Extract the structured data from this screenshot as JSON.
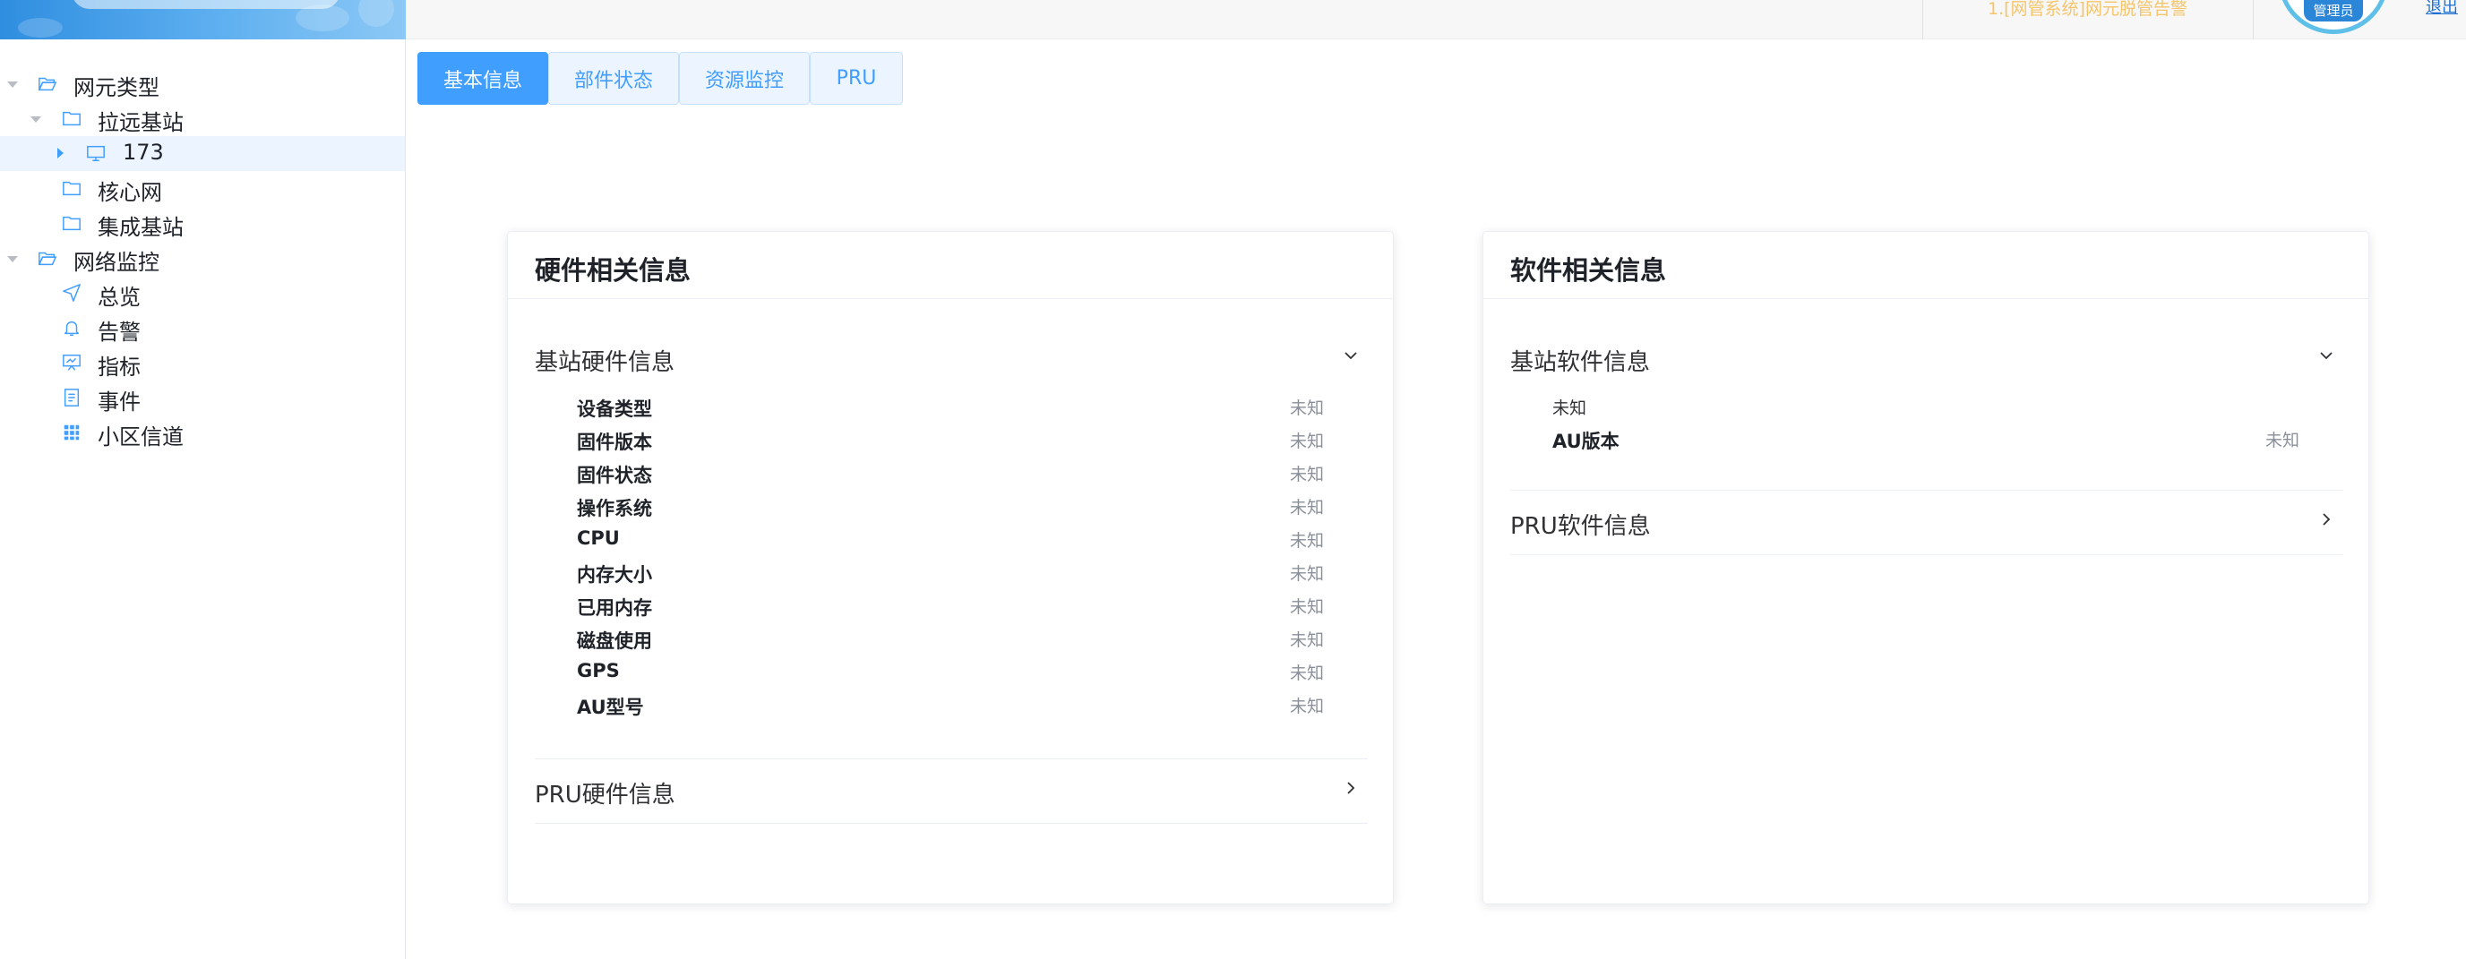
{
  "header": {
    "alert_text": "1.[网管系统]网元脱管告警",
    "avatar_badge": "管理员",
    "corner_link": "退出"
  },
  "tree": {
    "root1": "网元类型",
    "child_remote": "拉远基站",
    "node_173": "173",
    "child_core": "核心网",
    "child_integrated": "集成基站",
    "root2": "网络监控",
    "overview": "总览",
    "alarm": "告警",
    "metrics": "指标",
    "events": "事件",
    "cell_channel": "小区信道"
  },
  "tabs": {
    "basic": "基本信息",
    "component": "部件状态",
    "resource": "资源监控",
    "pru": "PRU"
  },
  "hardware": {
    "title": "硬件相关信息",
    "section_bs": "基站硬件信息",
    "section_pru": "PRU硬件信息",
    "rows": [
      {
        "label": "设备类型",
        "value": "未知"
      },
      {
        "label": "固件版本",
        "value": "未知"
      },
      {
        "label": "固件状态",
        "value": "未知"
      },
      {
        "label": "操作系统",
        "value": "未知"
      },
      {
        "label": "CPU",
        "value": "未知"
      },
      {
        "label": "内存大小",
        "value": "未知"
      },
      {
        "label": "已用内存",
        "value": "未知"
      },
      {
        "label": "磁盘使用",
        "value": "未知"
      },
      {
        "label": "GPS",
        "value": "未知"
      },
      {
        "label": "AU型号",
        "value": "未知"
      }
    ]
  },
  "software": {
    "title": "软件相关信息",
    "section_bs": "基站软件信息",
    "unknown_line": "未知",
    "au_label": "AU版本",
    "au_value": "未知",
    "section_pru": "PRU软件信息"
  },
  "colors": {
    "primary": "#409eff",
    "primary_light": "#ecf5ff",
    "alert": "#f6c56b",
    "muted": "#8a8f99"
  }
}
